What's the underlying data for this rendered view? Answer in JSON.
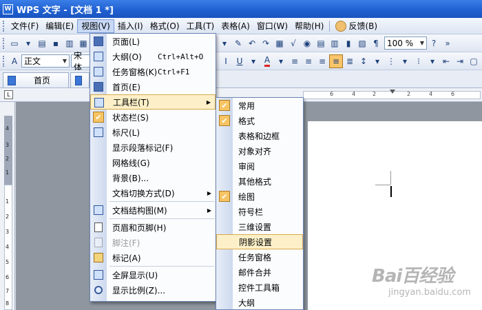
{
  "window": {
    "title": "WPS 文字 - [文档 1 *]",
    "app_icon_letter": "W"
  },
  "menubar": {
    "items": [
      "文件(F)",
      "编辑(E)",
      "视图(V)",
      "插入(I)",
      "格式(O)",
      "工具(T)",
      "表格(A)",
      "窗口(W)",
      "帮助(H)"
    ],
    "feedback": "反馈(B)"
  },
  "toolbar": {
    "zoom": "100 %",
    "style": "正文",
    "font": "宋体",
    "underline": "U",
    "font_color": "A"
  },
  "tabs": [
    "首页"
  ],
  "ruler": {
    "h_numbers": [
      "6",
      "4",
      "2",
      "2",
      "4",
      "6"
    ],
    "v_numbers": [
      "4",
      "3",
      "2",
      "1",
      "1",
      "2",
      "3",
      "4",
      "5",
      "6",
      "7",
      "8"
    ]
  },
  "view_menu": {
    "items": [
      {
        "label": "页面(L)"
      },
      {
        "label": "大纲(O)",
        "shortcut": "Ctrl+Alt+O"
      },
      {
        "label": "任务窗格(K)",
        "shortcut": "Ctrl+F1"
      },
      {
        "label": "首页(E)"
      },
      {
        "label": "工具栏(T)"
      },
      {
        "label": "状态栏(S)"
      },
      {
        "label": "标尺(L)"
      },
      {
        "label": "显示段落标记(F)"
      },
      {
        "label": "网格线(G)"
      },
      {
        "label": "背景(B)..."
      },
      {
        "label": "文档切换方式(D)"
      },
      {
        "label": "文档结构图(M)"
      },
      {
        "label": "页眉和页脚(H)"
      },
      {
        "label": "脚注(F)"
      },
      {
        "label": "标记(A)"
      },
      {
        "label": "全屏显示(U)"
      },
      {
        "label": "显示比例(Z)..."
      }
    ]
  },
  "toolbar_submenu": {
    "items": [
      "常用",
      "格式",
      "表格和边框",
      "对象对齐",
      "审阅",
      "其他格式",
      "绘图",
      "符号栏",
      "三维设置",
      "阴影设置",
      "任务窗格",
      "邮件合并",
      "控件工具箱",
      "大纲"
    ]
  },
  "watermark": {
    "logo": "Bai百经验",
    "site": "jingyan.baidu.com"
  }
}
